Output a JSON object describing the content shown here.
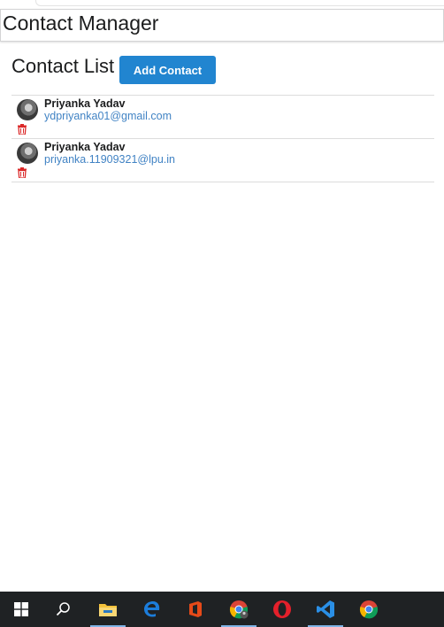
{
  "app": {
    "title": "Contact Manager"
  },
  "list": {
    "title": "Contact List",
    "add_button": "Add Contact"
  },
  "contacts": [
    {
      "name": "Priyanka Yadav",
      "email": "ydpriyanka01@gmail.com",
      "avatar": "avatar-photo"
    },
    {
      "name": "Priyanka Yadav",
      "email": "priyanka.11909321@lpu.in",
      "avatar": "avatar-photo"
    }
  ],
  "taskbar": {
    "icons": [
      "windows-start-icon",
      "search-icon",
      "file-explorer-icon",
      "edge-icon",
      "office-icon",
      "chrome-user-icon",
      "opera-icon",
      "vscode-icon",
      "chrome-icon"
    ]
  },
  "colors": {
    "primary_button": "#2185d0",
    "link": "#4183c4",
    "delete": "#db2828",
    "taskbar": "#1f2224"
  }
}
